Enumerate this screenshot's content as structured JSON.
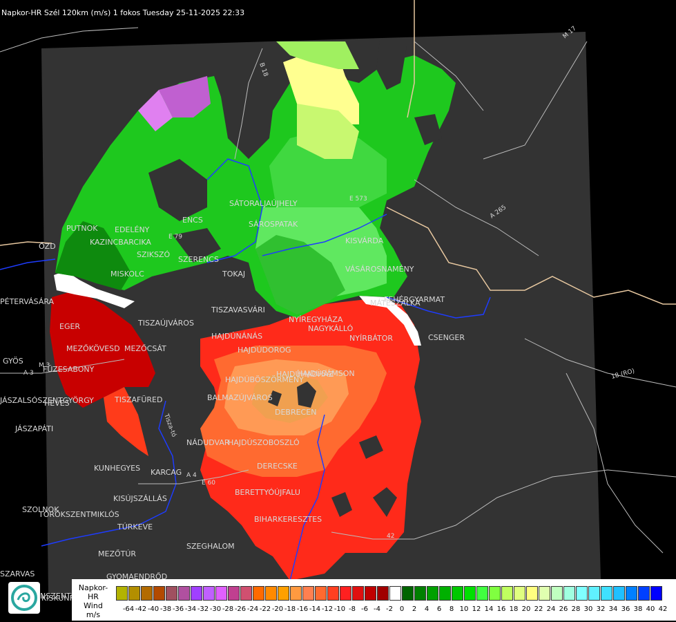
{
  "header": {
    "title": "Napkor-HR Szél 120km (m/s) 1 fokos Tuesday 25-11-2025 22:33"
  },
  "map": {
    "cities": [
      "SÁTORALJAÚJHELY",
      "SÁROSPATAK",
      "PUTNOK",
      "EDELÉNY",
      "KAZINCBARCIKA",
      "SZIKSZÓ",
      "ENCS",
      "SZERENCS",
      "TOKAJ",
      "MISKOLC",
      "PÉTERVÁSÁRA",
      "EGER",
      "TISZAÚJVÁROS",
      "TISZAVASVÁRI",
      "NYÍREGYHÁZA",
      "KISVÁRDA",
      "VÁSÁROSNAMÉNY",
      "FEHÉRGYARMAT",
      "MÁTÉSZALKA",
      "CSENGER",
      "NYÍRBÁTOR",
      "NAGYKÁLLÓ",
      "HAJDÚNÁNÁS",
      "HAJDÚDOROG",
      "HAJDÚBÖSZÖRMÉNY",
      "HAJDÚHADHÁZ",
      "HAJDÚSÁMSON",
      "DEBRECEN",
      "BALMAZÚJVÁROS",
      "MEZŐKÖVESD",
      "MEZŐCSÁT",
      "FÜZESABONY",
      "TISZAFÜRED",
      "HEVES",
      "GYÖS",
      "JÁSZAPÁTI",
      "JÁSZALSÓSZENTGYÖRGY",
      "KUNHEGYES",
      "KARCAG",
      "KISÚJSZÁLLÁS",
      "NÁDUDVAR",
      "HAJDÚSZOBOSZLÓ",
      "DERECSKE",
      "BERETTYÓÚJFALU",
      "BIHARKERESZTES",
      "SZOLNOK",
      "TÖRÖKSZENTMIKLÓS",
      "TÚRKEVE",
      "SZEGHALOM",
      "MEZŐTÚR",
      "GYOMAENDRŐD",
      "SZARVAS",
      "KISKUNFÉLEGYHÁZA",
      "ŐZD"
    ],
    "roads": [
      "B 18",
      "M 17",
      "A 265",
      "18 (RO)",
      "A 3",
      "E 60",
      "42",
      "E 573",
      "E 79",
      "A 4",
      "M 3"
    ],
    "river": "Tisza-tó"
  },
  "legend": {
    "title_line1": "Napkor-HR",
    "title_line2": "Wind",
    "unit": "m/s",
    "colors": [
      "#b3b300",
      "#b38f00",
      "#b36b00",
      "#b34a00",
      "#a05060",
      "#b050a0",
      "#a040ff",
      "#c060ff",
      "#e060ff",
      "#c04090",
      "#d05070",
      "#ff6a00",
      "#ff8a00",
      "#ffa000",
      "#ff9a40",
      "#ff8050",
      "#ff6a30",
      "#ff4020",
      "#ff2020",
      "#e01010",
      "#c00000",
      "#a00000",
      "#ffffff",
      "#006400",
      "#008000",
      "#00a000",
      "#00b000",
      "#00c800",
      "#00e000",
      "#40ff40",
      "#80ff40",
      "#c0ff60",
      "#e0ff80",
      "#ffff80",
      "#e0ffb0",
      "#c0ffc0",
      "#a0ffe0",
      "#80ffff",
      "#60f0ff",
      "#40e0ff",
      "#20c0ff",
      "#0080ff",
      "#0040ff",
      "#0000ff",
      "#0000c0"
    ],
    "ticks": [
      "-64",
      "-42",
      "-40",
      "-38",
      "-36",
      "-34",
      "-32",
      "-30",
      "-28",
      "-26",
      "-24",
      "-22",
      "-20",
      "-18",
      "-16",
      "-14",
      "-12",
      "-10",
      "-8",
      "-6",
      "-4",
      "-2",
      "0",
      "2",
      "4",
      "6",
      "8",
      "10",
      "12",
      "14",
      "16",
      "18",
      "20",
      "22",
      "24",
      "26",
      "28",
      "30",
      "32",
      "34",
      "36",
      "38",
      "40",
      "42"
    ]
  },
  "bottom_label": "NSZENTI"
}
